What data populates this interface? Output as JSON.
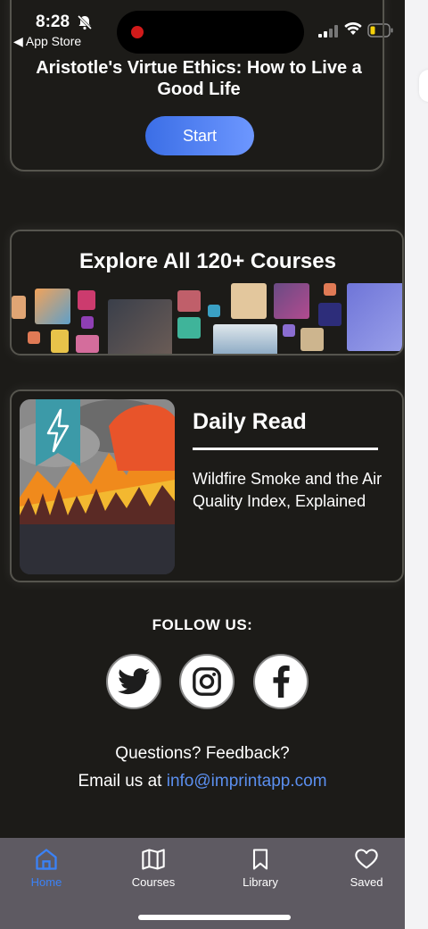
{
  "status_bar": {
    "time": "8:28",
    "back_app": "◀ App Store"
  },
  "course_card": {
    "title": "Aristotle's Virtue Ethics: How to Live a Good Life",
    "start_label": "Start"
  },
  "explore": {
    "title": "Explore All 120+ Courses"
  },
  "daily_read": {
    "heading": "Daily Read",
    "description": "Wildfire Smoke and the Air Quality Index, Explained",
    "badge_icon": "lightning-bolt-icon"
  },
  "follow": {
    "label": "FOLLOW US:",
    "networks": [
      "twitter-icon",
      "instagram-icon",
      "facebook-icon"
    ]
  },
  "contact": {
    "questions": "Questions? Feedback?",
    "email_prefix": "Email us at ",
    "email": "info@imprintapp.com"
  },
  "tabs": [
    {
      "label": "Home",
      "icon": "home-icon",
      "active": true
    },
    {
      "label": "Courses",
      "icon": "map-icon",
      "active": false
    },
    {
      "label": "Library",
      "icon": "bookmark-icon",
      "active": false
    },
    {
      "label": "Saved",
      "icon": "heart-icon",
      "active": false
    }
  ],
  "colors": {
    "background": "#1c1b18",
    "accent": "#3b82f6",
    "link": "#5b8fef",
    "tabbar": "#5e5a62",
    "start_gradient": [
      "#3b6ee6",
      "#6d97ff"
    ]
  }
}
